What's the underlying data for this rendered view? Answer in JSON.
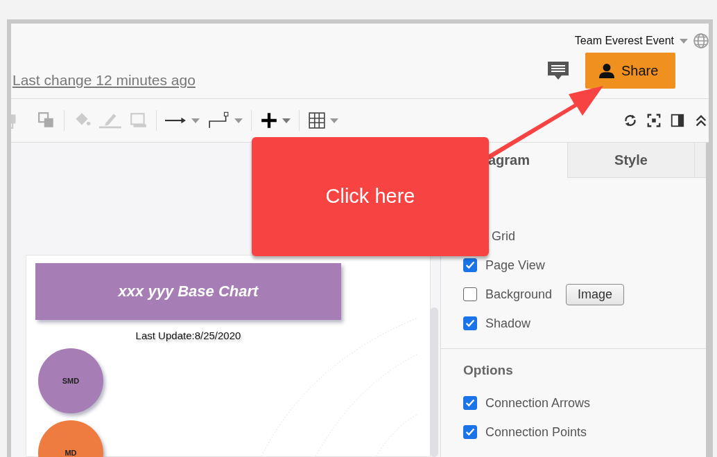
{
  "header": {
    "team": "Team Everest Event",
    "last_change": "Last change 12 minutes ago",
    "share_button": "Share"
  },
  "diagram": {
    "title": "xxx yyy Base Chart",
    "subtitle": "Last Update:8/25/2020",
    "nodes": [
      {
        "label": "SMD",
        "color": "#a67db4"
      },
      {
        "label": "MD",
        "color": "#ee7b3f"
      }
    ]
  },
  "panel": {
    "tabs": [
      {
        "label": "agram",
        "selected": true
      },
      {
        "label": "Style",
        "selected": false
      }
    ],
    "view_options": [
      {
        "label": "Grid"
      },
      {
        "label": "Page View",
        "checked": true
      },
      {
        "label": "Background",
        "checked": false,
        "button": "Image"
      },
      {
        "label": "Shadow",
        "checked": true
      }
    ],
    "options_heading": "Options",
    "options": [
      {
        "label": "Connection Arrows",
        "checked": true
      },
      {
        "label": "Connection Points",
        "checked": true
      }
    ]
  },
  "callout": {
    "text": "Click here"
  }
}
